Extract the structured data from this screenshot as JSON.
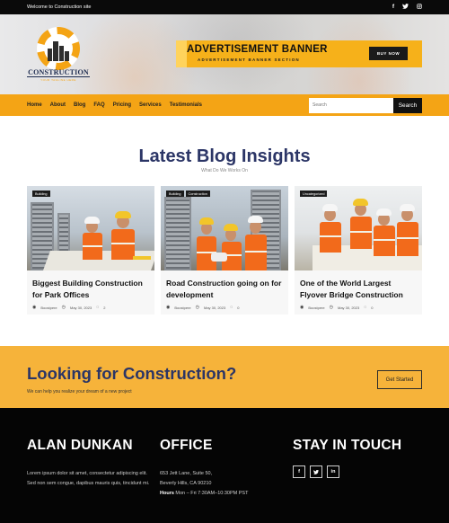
{
  "topbar": {
    "welcome": "Welcome to Construction site",
    "social_icons": [
      "facebook-icon",
      "twitter-icon",
      "instagram-icon"
    ],
    "social_glyphs": [
      "f",
      "t",
      "◎"
    ]
  },
  "logo": {
    "name": "CONSTRUCTION",
    "tagline": "YOUR TAGLINE HERE"
  },
  "ad_banner": {
    "title": "ADVERTISEMENT BANNER",
    "subtitle": "ADVERTISEMENT BANNER SECTION",
    "button": "BUY NOW"
  },
  "nav": {
    "links": [
      "Home",
      "About",
      "Blog",
      "FAQ",
      "Pricing",
      "Services",
      "Testimonials"
    ],
    "search_placeholder": "Search",
    "search_button": "Search"
  },
  "blog": {
    "title": "Latest Blog Insights",
    "subtitle": "What Do We Works On",
    "posts": [
      {
        "tags": [
          "Building"
        ],
        "title": "Biggest Building Construction for Park Offices",
        "author": "Boostpere",
        "date": "May 30, 2023",
        "comments": "2"
      },
      {
        "tags": [
          "Building",
          "Construction"
        ],
        "title": "Road Construction going on for development",
        "author": "Boostpere",
        "date": "May 30, 2023",
        "comments": "0"
      },
      {
        "tags": [
          "Uncategorized"
        ],
        "title": "One of the World Largest Flyover Bridge Construction",
        "author": "Boostpere",
        "date": "May 30, 2023",
        "comments": "0"
      }
    ]
  },
  "cta": {
    "title": "Looking for Construction?",
    "subtitle": "We can help you realize your dream of a new project",
    "button": "Get Started"
  },
  "footer": {
    "about_title": "ALAN DUNKAN",
    "about_text": "Lorem ipsum dolor sit amet, consectetur adipiscing elit. Sed non sem congue, dapibus mauris quis, tincidunt mi.",
    "office_title": "OFFICE",
    "office_line1": "653 Jett Lane, Suite 50,",
    "office_line2": "Beverly Hills, CA 90210",
    "hours_label": "Hours",
    "hours_value": "Mon – Fri 7:30AM–10:30PM PST",
    "stay_title": "STAY IN TOUCH",
    "social_icons": [
      "facebook-icon",
      "twitter-icon",
      "linkedin-icon"
    ],
    "social_glyphs": [
      "f",
      "t",
      "in"
    ]
  },
  "colors": {
    "accent": "#f4a415",
    "navy": "#2b3566",
    "footer_bg": "#050505"
  }
}
